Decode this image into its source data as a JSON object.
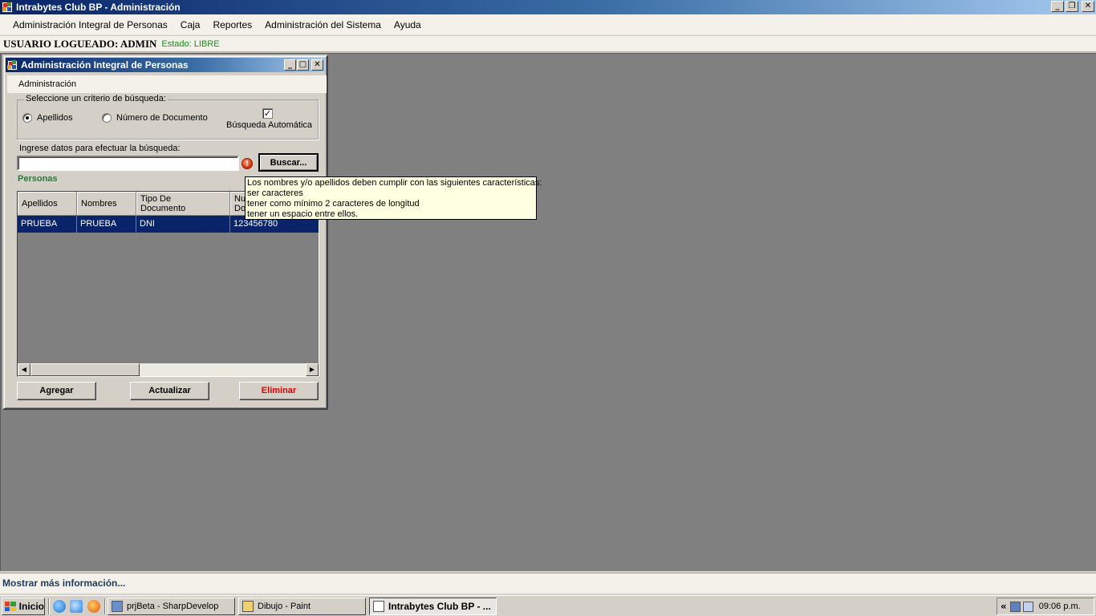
{
  "app": {
    "title": "Intrabytes Club BP - Administración",
    "controls": [
      "_",
      "❐",
      "✕"
    ]
  },
  "menu": {
    "items": [
      "Administración Integral de Personas",
      "Caja",
      "Reportes",
      "Administración del Sistema",
      "Ayuda"
    ]
  },
  "status": {
    "user": "USUARIO LOGUEADO: ADMIN",
    "state": "Estado: LIBRE"
  },
  "child": {
    "title": "Administración Integral de Personas",
    "controls": [
      "_",
      "□",
      "✕"
    ],
    "menu_item": "Administración",
    "criteria_legend": "Seleccione un criterio de búsqueda:",
    "radio_apellidos": "Apellidos",
    "radio_documento": "Número de Documento",
    "auto_search_label": "Búsqueda Automática",
    "auto_search_checked": true,
    "check_mark": "✓",
    "search_label": "Ingrese datos para efectuar la búsqueda:",
    "search_value": "",
    "error_glyph": "!",
    "search_button": "Buscar...",
    "section_label": "Personas",
    "columns": [
      "Apellidos",
      "Nombres",
      "Tipo De\nDocumento",
      "Nu\nDo"
    ],
    "rows": [
      [
        "PRUEBA",
        "PRUEBA",
        "DNI",
        "123456780"
      ]
    ],
    "scroll_left": "◀",
    "scroll_right": "▶",
    "add_button": "Agregar",
    "update_button": "Actualizar",
    "delete_button": "Eliminar"
  },
  "tooltip": {
    "lines": [
      "Los nombres y/o apellidos deben cumplir con las siguientes características:",
      " ser caracteres",
      " tener como mínimo 2 caracteres de longitud",
      " tener un espacio entre ellos."
    ]
  },
  "infobar": {
    "text": "Mostrar más información..."
  },
  "taskbar": {
    "start": "Inicio",
    "tasks": [
      "prjBeta - SharpDevelop",
      "Dibujo - Paint",
      "Intrabytes Club BP - ..."
    ],
    "tray_arrow": "«",
    "clock": "09:06 p.m."
  },
  "colors": {
    "title_gradient_start": "#0a246a",
    "title_gradient_end": "#a6caf0",
    "mdi_background": "#808080",
    "selected_row": "#0a246a",
    "state_green": "#1b8a1b",
    "delete_red": "#e00000",
    "tooltip_bg": "#ffffe1"
  }
}
